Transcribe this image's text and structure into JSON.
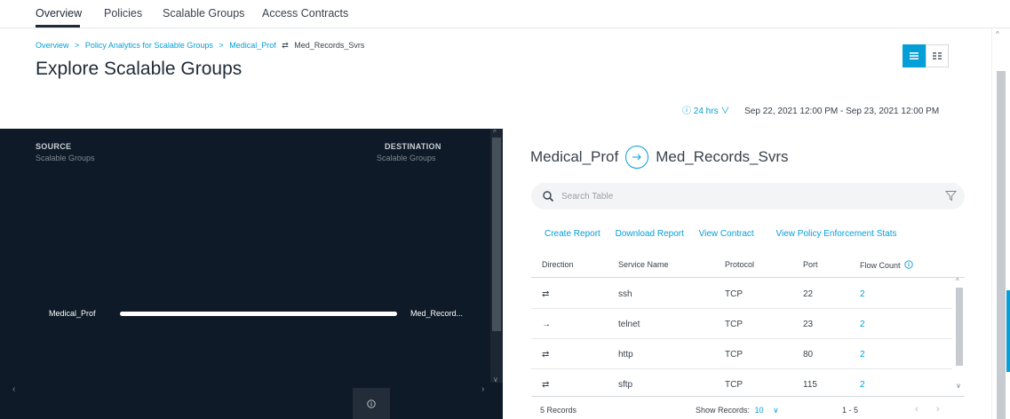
{
  "nav": {
    "tabs": [
      {
        "label": "Overview",
        "active": true
      },
      {
        "label": "Policies",
        "active": false
      },
      {
        "label": "Scalable Groups",
        "active": false
      },
      {
        "label": "Access Contracts",
        "active": false
      }
    ]
  },
  "breadcrumb": {
    "items": [
      "Overview",
      "Policy Analytics for Scalable Groups",
      "Medical_Prof"
    ],
    "separator": ">",
    "current": "Med_Records_Svrs",
    "current_icon": "bidirectional-arrow-icon"
  },
  "page_title": "Explore Scalable Groups",
  "view_toggle": {
    "active": "list-view",
    "options": [
      "list-view-icon",
      "grid-view-icon"
    ]
  },
  "time_range": {
    "duration": "24 hrs",
    "range": "Sep 22, 2021 12:00 PM - Sep 23, 2021 12:00 PM"
  },
  "visualization": {
    "source_label": "SOURCE",
    "source_sub": "Scalable Groups",
    "destination_label": "DESTINATION",
    "destination_sub": "Scalable Groups",
    "source_node": "Medical_Prof",
    "destination_node": "Med_Record...",
    "background": "#0e1a27"
  },
  "detail": {
    "source": "Medical_Prof",
    "destination": "Med_Records_Svrs",
    "search_placeholder": "Search Table",
    "actions": [
      "Create Report",
      "Download Report",
      "View Contract",
      "View Policy Enforcement Stats"
    ],
    "columns": [
      "Direction",
      "Service Name",
      "Protocol",
      "Port",
      "Flow Count"
    ],
    "rows": [
      {
        "direction": "⇄",
        "service": "ssh",
        "protocol": "TCP",
        "port": "22",
        "flow_count": "2"
      },
      {
        "direction": "→",
        "service": "telnet",
        "protocol": "TCP",
        "port": "23",
        "flow_count": "2"
      },
      {
        "direction": "⇄",
        "service": "http",
        "protocol": "TCP",
        "port": "80",
        "flow_count": "2"
      },
      {
        "direction": "⇄",
        "service": "sftp",
        "protocol": "TCP",
        "port": "115",
        "flow_count": "2"
      }
    ],
    "footer": {
      "records": "5 Records",
      "show_records_label": "Show Records:",
      "show_records_value": "10",
      "range": "1 - 5"
    }
  },
  "colors": {
    "accent": "#049fd9",
    "text": "#1f2a36"
  }
}
